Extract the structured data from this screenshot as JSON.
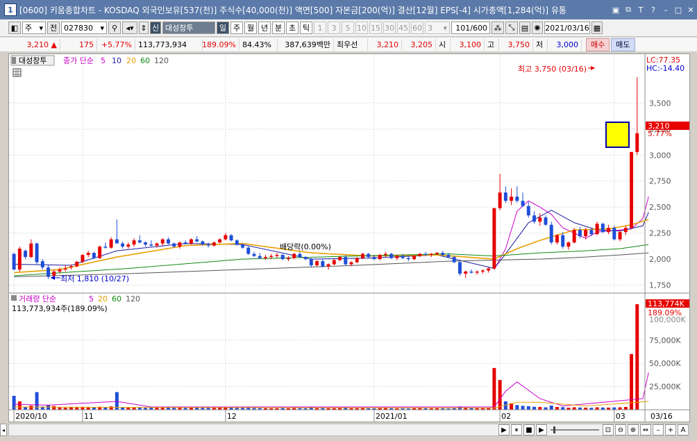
{
  "titlebar": {
    "app_num": "1",
    "title": "[0600] 키움종합차트 - KOSDAQ 외국인보유[537(천)] 주식수[40,000(천)] 액면[500] 자본금[200(억)] 결산[12월] EPS[-4] 시가총액[1,284(억)] 유통",
    "window_buttons": [
      "T",
      "?",
      "–",
      "□",
      "✕"
    ]
  },
  "toolbar": {
    "market": "주",
    "prev": "전",
    "code": "027830",
    "badge": "신",
    "name": "대성창투",
    "periods": [
      "일",
      "주",
      "월",
      "년",
      "분",
      "초",
      "틱"
    ],
    "minutes": [
      "1",
      "3",
      "5",
      "10",
      "15",
      "30",
      "45",
      "60"
    ],
    "tick": "3",
    "count": "101/600",
    "date": "2021/03/16"
  },
  "quote": {
    "price": "3,210",
    "arrow": "▲",
    "change": "175",
    "pct": "+5.77%",
    "volume": "113,773,934",
    "vol_ratio": "189.09%",
    "turnover": "84.43%",
    "amount": "387,639백만",
    "best_label": "최우선",
    "ask": "3,210",
    "bid": "3,205",
    "open_label": "시",
    "open": "3,100",
    "high_label": "고",
    "high": "3,750",
    "low_label": "저",
    "low": "3,000",
    "buy": "매수",
    "sell": "매도"
  },
  "legend": {
    "name": "대성창투",
    "ma_label": "종가 단순",
    "ma": [
      "5",
      "10",
      "20",
      "60",
      "120"
    ],
    "vol_label": "거래량 단순",
    "vol_ma": [
      "5",
      "20",
      "60",
      "120"
    ],
    "vol_value": "113,773,934주(189.09%)"
  },
  "annotations": {
    "lc": "LC:77.35",
    "hc": "HC:-14.40",
    "high_label": "최고 3,750 (03/16)",
    "low_label": "최저 1,810 (10/27)",
    "dividend": "배당락(0.00%)",
    "cur_price": "3,210",
    "cur_pct": "5.77%",
    "vol_tag": "113,774K",
    "vol_pct": "189.09%",
    "vol_hidden": "100,000K"
  },
  "colors": {
    "up": "#e60000",
    "down": "#1f4ed8",
    "ma5": "#c800c8",
    "ma10": "#1a1aa0",
    "ma20": "#e8a000",
    "ma60": "#118811",
    "ma120": "#555555"
  },
  "chart_data": {
    "type": "candlestick",
    "ylim": [
      1700,
      3850
    ],
    "yticks": [
      "3,500",
      "3,250",
      "3,000",
      "2,750",
      "2,500",
      "2,250",
      "2,000",
      "1,750"
    ],
    "yticks_values": [
      3500,
      3250,
      3000,
      2750,
      2500,
      2250,
      2000,
      1750
    ],
    "vol_ylim": [
      0,
      113774
    ],
    "vol_yticks": [
      "75,000K",
      "50,000K",
      "25,000K"
    ],
    "vol_yticks_values": [
      75000,
      50000,
      25000
    ],
    "xlabels": [
      {
        "i": 0,
        "text": "2020/10"
      },
      {
        "i": 12,
        "text": "11"
      },
      {
        "i": 37,
        "text": "12"
      },
      {
        "i": 63,
        "text": "2021/01"
      },
      {
        "i": 85,
        "text": "02"
      },
      {
        "i": 105,
        "text": "03"
      }
    ],
    "right_date": "03/16",
    "candles": [
      [
        2050,
        2060,
        1890,
        1900,
        15000
      ],
      [
        1900,
        2120,
        1880,
        2100,
        9000
      ],
      [
        2080,
        2095,
        2000,
        2020,
        3000
      ],
      [
        2020,
        2190,
        2010,
        2150,
        4500
      ],
      [
        2150,
        2160,
        1950,
        1970,
        19000
      ],
      [
        1980,
        2000,
        1900,
        1920,
        3500
      ],
      [
        1920,
        1940,
        1810,
        1830,
        5000
      ],
      [
        1840,
        1900,
        1830,
        1880,
        4000
      ],
      [
        1880,
        1920,
        1860,
        1900,
        2500
      ],
      [
        1900,
        1940,
        1880,
        1910,
        2200
      ],
      [
        1920,
        1950,
        1900,
        1930,
        3000
      ],
      [
        1930,
        1980,
        1920,
        1975,
        2700
      ],
      [
        1975,
        2050,
        1960,
        2040,
        3200
      ],
      [
        2040,
        2080,
        2020,
        2060,
        2800
      ],
      [
        2060,
        2070,
        2000,
        2010,
        2400
      ],
      [
        2010,
        2130,
        2000,
        2120,
        3200
      ],
      [
        2120,
        2160,
        2100,
        2110,
        2600
      ],
      [
        2110,
        2210,
        2100,
        2190,
        3600
      ],
      [
        2190,
        2380,
        2180,
        2150,
        19000
      ],
      [
        2150,
        2170,
        2100,
        2120,
        2500
      ],
      [
        2120,
        2160,
        2100,
        2140,
        2200
      ],
      [
        2140,
        2200,
        2120,
        2180,
        2400
      ],
      [
        2180,
        2230,
        2150,
        2160,
        2600
      ],
      [
        2160,
        2170,
        2120,
        2140,
        2100
      ],
      [
        2140,
        2180,
        2120,
        2130,
        2300
      ],
      [
        2130,
        2160,
        2110,
        2150,
        2200
      ],
      [
        2150,
        2200,
        2130,
        2190,
        2500
      ],
      [
        2190,
        2210,
        2140,
        2150,
        2200
      ],
      [
        2150,
        2160,
        2110,
        2120,
        2000
      ],
      [
        2120,
        2170,
        2100,
        2160,
        2100
      ],
      [
        2160,
        2180,
        2140,
        2150,
        2000
      ],
      [
        2150,
        2200,
        2140,
        2190,
        2200
      ],
      [
        2190,
        2220,
        2160,
        2170,
        2400
      ],
      [
        2170,
        2180,
        2130,
        2140,
        2100
      ],
      [
        2140,
        2160,
        2110,
        2130,
        1900
      ],
      [
        2130,
        2170,
        2120,
        2160,
        2000
      ],
      [
        2160,
        2200,
        2150,
        2190,
        2200
      ],
      [
        2190,
        2250,
        2180,
        2230,
        3000
      ],
      [
        2230,
        2240,
        2170,
        2180,
        2300
      ],
      [
        2180,
        2190,
        2130,
        2140,
        2100
      ],
      [
        2140,
        2150,
        2100,
        2110,
        2000
      ],
      [
        2110,
        2130,
        2040,
        2050,
        2300
      ],
      [
        2050,
        2070,
        2020,
        2030,
        1800
      ],
      [
        2030,
        2060,
        2000,
        2010,
        1700
      ],
      [
        2010,
        2040,
        1990,
        2020,
        1600
      ],
      [
        2020,
        2050,
        2000,
        2030,
        1500
      ],
      [
        2030,
        2060,
        2010,
        2040,
        1600
      ],
      [
        2040,
        2050,
        1990,
        2000,
        1700
      ],
      [
        2000,
        2030,
        1980,
        2010,
        1500
      ],
      [
        2010,
        2060,
        2000,
        2050,
        1700
      ],
      [
        2050,
        2070,
        2010,
        2020,
        1600
      ],
      [
        2020,
        2030,
        1990,
        2000,
        1500
      ],
      [
        2000,
        2010,
        1920,
        1940,
        1900
      ],
      [
        1940,
        1990,
        1930,
        1980,
        1600
      ],
      [
        1980,
        2000,
        1920,
        1930,
        1700
      ],
      [
        1930,
        1960,
        1900,
        1950,
        1500
      ],
      [
        1950,
        2000,
        1940,
        1990,
        1600
      ],
      [
        1990,
        2030,
        1980,
        2020,
        1700
      ],
      [
        2020,
        2040,
        1940,
        1950,
        1800
      ],
      [
        1950,
        1980,
        1930,
        1970,
        1500
      ],
      [
        1970,
        2020,
        1960,
        2010,
        1600
      ],
      [
        2010,
        2060,
        2000,
        2050,
        1700
      ],
      [
        2050,
        2060,
        2010,
        2020,
        1500
      ],
      [
        2020,
        2040,
        1990,
        2000,
        1400
      ],
      [
        2000,
        2050,
        1990,
        2040,
        1600
      ],
      [
        2040,
        2070,
        2020,
        2050,
        1700
      ],
      [
        2050,
        2060,
        2000,
        2010,
        1500
      ],
      [
        2010,
        2040,
        1990,
        2030,
        1400
      ],
      [
        2030,
        2050,
        2000,
        2010,
        1400
      ],
      [
        2010,
        2030,
        1980,
        2000,
        1300
      ],
      [
        2000,
        2040,
        1990,
        2030,
        1500
      ],
      [
        2030,
        2060,
        2020,
        2050,
        1600
      ],
      [
        2050,
        2070,
        2030,
        2040,
        1500
      ],
      [
        2040,
        2060,
        2020,
        2050,
        1400
      ],
      [
        2050,
        2070,
        2040,
        2060,
        1500
      ],
      [
        2060,
        2080,
        2030,
        2040,
        1400
      ],
      [
        2040,
        2060,
        2010,
        2020,
        1300
      ],
      [
        2020,
        2030,
        1960,
        1970,
        1600
      ],
      [
        1970,
        1980,
        1840,
        1860,
        3500
      ],
      [
        1860,
        1890,
        1820,
        1880,
        2400
      ],
      [
        1880,
        1900,
        1860,
        1870,
        1800
      ],
      [
        1870,
        1890,
        1850,
        1880,
        1600
      ],
      [
        1880,
        1900,
        1860,
        1890,
        1500
      ],
      [
        1890,
        1920,
        1870,
        1910,
        1600
      ],
      [
        1910,
        2490,
        1900,
        2490,
        45000
      ],
      [
        2490,
        2820,
        2470,
        2640,
        32000
      ],
      [
        2640,
        2700,
        2540,
        2560,
        9000
      ],
      [
        2560,
        2680,
        2520,
        2600,
        7000
      ],
      [
        2600,
        2700,
        2540,
        2560,
        5000
      ],
      [
        2560,
        2640,
        2500,
        2510,
        4200
      ],
      [
        2510,
        2550,
        2400,
        2420,
        3800
      ],
      [
        2420,
        2460,
        2340,
        2360,
        3200
      ],
      [
        2360,
        2440,
        2320,
        2400,
        3000
      ],
      [
        2400,
        2420,
        2320,
        2330,
        2600
      ],
      [
        2330,
        2360,
        2140,
        2160,
        4500
      ],
      [
        2160,
        2240,
        2140,
        2230,
        3000
      ],
      [
        2230,
        2260,
        2100,
        2120,
        2800
      ],
      [
        2120,
        2170,
        2090,
        2160,
        2200
      ],
      [
        2160,
        2300,
        2150,
        2280,
        2600
      ],
      [
        2280,
        2310,
        2200,
        2220,
        2400
      ],
      [
        2220,
        2300,
        2190,
        2280,
        2200
      ],
      [
        2280,
        2300,
        2220,
        2240,
        2100
      ],
      [
        2240,
        2360,
        2230,
        2340,
        2600
      ],
      [
        2340,
        2350,
        2250,
        2260,
        2400
      ],
      [
        2260,
        2330,
        2240,
        2300,
        2300
      ],
      [
        2300,
        2320,
        2180,
        2190,
        2500
      ],
      [
        2190,
        2280,
        2170,
        2260,
        2600
      ],
      [
        2260,
        2320,
        2230,
        2300,
        3000
      ],
      [
        2300,
        3030,
        2290,
        3030,
        60000
      ],
      [
        3030,
        3750,
        3000,
        3210,
        113774
      ]
    ],
    "ma_series": {
      "ma5": [
        [
          84,
          1900
        ],
        [
          86,
          2100
        ],
        [
          88,
          2460
        ],
        [
          90,
          2560
        ],
        [
          92,
          2500
        ],
        [
          94,
          2430
        ],
        [
          96,
          2300
        ],
        [
          98,
          2250
        ],
        [
          100,
          2200
        ],
        [
          102,
          2260
        ],
        [
          104,
          2270
        ],
        [
          106,
          2280
        ],
        [
          108,
          2290
        ],
        [
          110,
          2390
        ],
        [
          111,
          2600
        ]
      ],
      "ma10": [
        [
          0,
          1950
        ],
        [
          10,
          1940
        ],
        [
          18,
          2080
        ],
        [
          30,
          2150
        ],
        [
          40,
          2140
        ],
        [
          52,
          2000
        ],
        [
          62,
          2010
        ],
        [
          74,
          2040
        ],
        [
          84,
          1910
        ],
        [
          86,
          2050
        ],
        [
          90,
          2350
        ],
        [
          94,
          2470
        ],
        [
          98,
          2350
        ],
        [
          102,
          2280
        ],
        [
          106,
          2270
        ],
        [
          110,
          2320
        ],
        [
          111,
          2450
        ]
      ],
      "ma20": [
        [
          0,
          1870
        ],
        [
          8,
          1900
        ],
        [
          18,
          2020
        ],
        [
          30,
          2130
        ],
        [
          40,
          2150
        ],
        [
          52,
          2060
        ],
        [
          62,
          2030
        ],
        [
          74,
          2040
        ],
        [
          84,
          2000
        ],
        [
          88,
          2100
        ],
        [
          92,
          2180
        ],
        [
          98,
          2280
        ],
        [
          104,
          2290
        ],
        [
          108,
          2330
        ],
        [
          111,
          2380
        ]
      ],
      "ma60": [
        [
          0,
          1840
        ],
        [
          20,
          1910
        ],
        [
          40,
          2000
        ],
        [
          60,
          2030
        ],
        [
          76,
          2050
        ],
        [
          84,
          2030
        ],
        [
          92,
          2060
        ],
        [
          100,
          2080
        ],
        [
          106,
          2100
        ],
        [
          111,
          2140
        ]
      ],
      "ma120": [
        [
          0,
          1830
        ],
        [
          20,
          1860
        ],
        [
          40,
          1900
        ],
        [
          60,
          1940
        ],
        [
          76,
          1980
        ],
        [
          84,
          1990
        ],
        [
          92,
          2000
        ],
        [
          100,
          2020
        ],
        [
          106,
          2040
        ],
        [
          111,
          2060
        ]
      ]
    },
    "vol_ma": {
      "vma5": [
        [
          0,
          6000
        ],
        [
          6,
          5000
        ],
        [
          18,
          9000
        ],
        [
          24,
          3000
        ],
        [
          84,
          3000
        ],
        [
          86,
          20000
        ],
        [
          88,
          30000
        ],
        [
          92,
          12000
        ],
        [
          96,
          4000
        ],
        [
          110,
          12000
        ],
        [
          111,
          40000
        ]
      ],
      "vma20": [
        [
          0,
          3000
        ],
        [
          30,
          2400
        ],
        [
          84,
          2000
        ],
        [
          88,
          8000
        ],
        [
          92,
          8000
        ],
        [
          100,
          4000
        ],
        [
          111,
          9000
        ]
      ]
    }
  }
}
